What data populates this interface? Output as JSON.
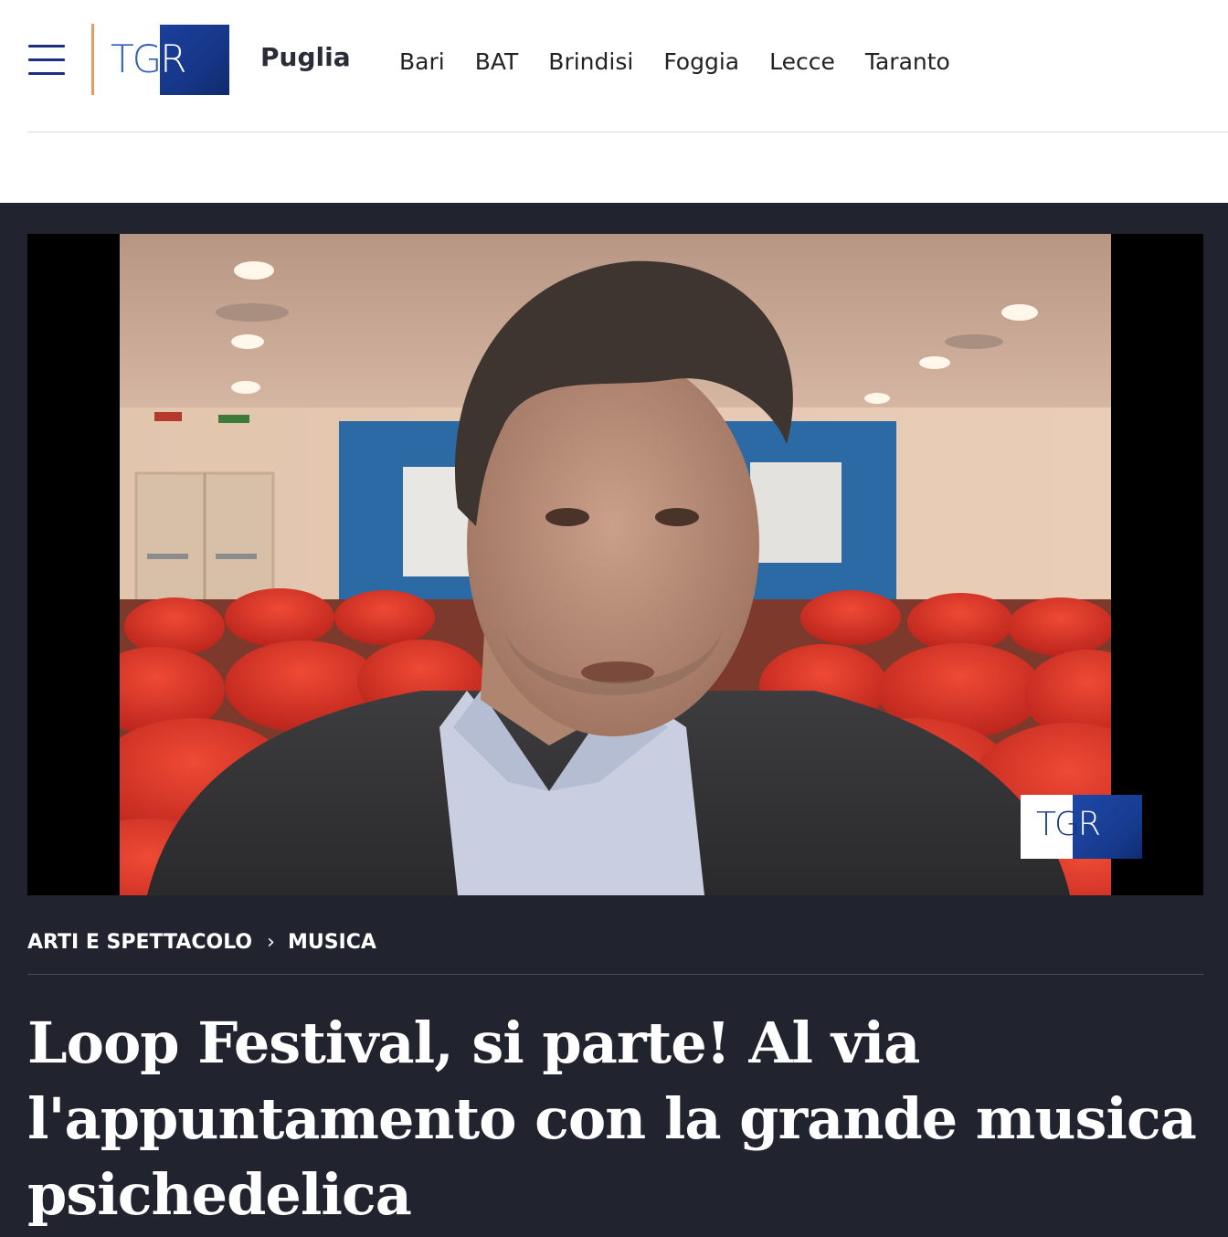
{
  "header": {
    "logo_text_left": "TG",
    "logo_text_right": "R",
    "region": "Puglia",
    "nav": [
      "Bari",
      "BAT",
      "Brindisi",
      "Foggia",
      "Lecce",
      "Taranto"
    ],
    "colors": {
      "brand_blue": "#1c2f86",
      "accent_orange": "#e59b5a"
    }
  },
  "video": {
    "watermark_left": "TG",
    "watermark_right": "R"
  },
  "article": {
    "breadcrumb": [
      "ARTI E SPETTACOLO",
      "MUSICA"
    ],
    "breadcrumb_separator": "›",
    "title": "Loop Festival, si parte! Al via l'appuntamento con la grande musica psichedelica",
    "background_color": "#21232f"
  }
}
